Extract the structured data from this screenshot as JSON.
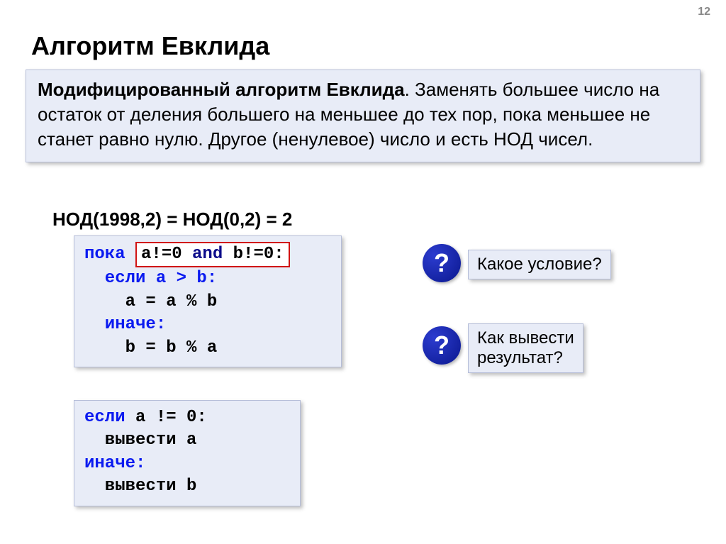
{
  "page_number": "12",
  "title": "Алгоритм Евклида",
  "description": {
    "strong": "Модифицированный алгоритм Евклида",
    "text": ". Заменять большее число на остаток от деления большего на меньшее до тех пор, пока меньшее не станет равно нулю. Другое (ненулевое) число и есть НОД чисел."
  },
  "equation": "НОД(1998,2) = НОД(0,2) = 2",
  "code1": {
    "l1_pre": "пока ",
    "l1_cond_a": "a!=0 ",
    "l1_cond_and": "and",
    "l1_cond_b": " b!=0:",
    "l2": "  если a > b:",
    "l3": "    a = a % b",
    "l4": "  иначе:",
    "l5": "    b = b % a"
  },
  "code2": {
    "l1_a": "если",
    "l1_b": " a != 0:",
    "l2": "  вывести a",
    "l3": "иначе:",
    "l4": "  вывести b"
  },
  "q_icon": "?",
  "question1": "Какое условие?",
  "question2_l1": "Как вывести",
  "question2_l2": "результат?"
}
